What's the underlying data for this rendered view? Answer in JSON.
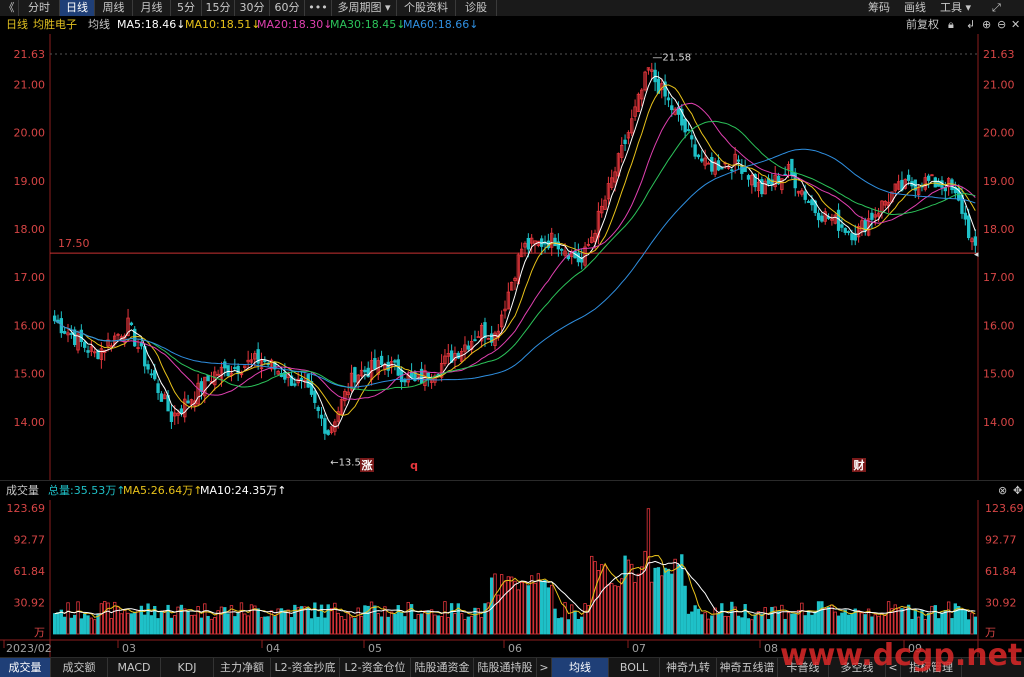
{
  "toolbar": {
    "back": "《",
    "tabs": [
      "分时",
      "日线",
      "周线",
      "月线",
      "5分",
      "15分",
      "30分",
      "60分",
      "•••",
      "多周期图 ▾",
      "个股资料",
      "诊股"
    ],
    "active_tab": "日线",
    "right": [
      "筹码",
      "画线",
      "工具 ▾"
    ]
  },
  "ma_bar": {
    "period": "日线",
    "stock_name": "均胜电子",
    "label": "均线",
    "ma5": "MA5:18.46↓",
    "ma10": "MA10:18.51↓",
    "ma20": "MA20:18.30↓",
    "ma30": "MA30:18.45↓",
    "ma60": "MA60:18.66↓",
    "adjust": "前复权"
  },
  "colors": {
    "up": "#e8373d",
    "down": "#1fc1c8",
    "ma5": "#ffffff",
    "ma10": "#e8c21a",
    "ma20": "#e040b0",
    "ma30": "#2cc35a",
    "ma60": "#2f8fe0"
  },
  "price_axis": {
    "ticks": [
      "21.63",
      "21.00",
      "20.00",
      "19.00",
      "18.00",
      "17.00",
      "16.00",
      "15.00",
      "14.00"
    ],
    "ref_line": "17.50",
    "high_label": "21.58",
    "low_label": "13.51"
  },
  "markers": {
    "zhang": "涨",
    "q": "q",
    "cai": "财"
  },
  "volume_bar": {
    "title": "成交量",
    "total": "总量:35.53万↑",
    "ma5": "MA5:26.64万↑",
    "ma10": "MA10:24.35万↑",
    "ticks": [
      "123.69",
      "92.77",
      "61.84",
      "30.92",
      "万"
    ],
    "dates": [
      "2023/02",
      "03",
      "04",
      "05",
      "06",
      "07",
      "08",
      "09"
    ]
  },
  "bottom_tabs": [
    "成交量",
    "成交额",
    "MACD",
    "KDJ",
    "主力净额",
    "L2-资金抄底",
    "L2-资金仓位",
    "陆股通资金",
    "陆股通持股",
    ">",
    "均线",
    "BOLL",
    "神奇九转",
    "神奇五线谱",
    "卡普线",
    "多空线",
    "<",
    "指标管理"
  ],
  "bottom_selected": [
    "成交量",
    "均线"
  ],
  "watermark": "www.dcgp.net",
  "chart_data": {
    "type": "candlestick",
    "title": "均胜电子 日线",
    "x_range": [
      "2023/02",
      "2023/09"
    ],
    "ylim": [
      13.5,
      21.63
    ],
    "price_high": 21.58,
    "price_low": 13.51,
    "reference": 17.5,
    "ohlc_keypoints": [
      {
        "date": "2023/02",
        "close": 16.1
      },
      {
        "date": "2023/03",
        "close": 15.4
      },
      {
        "date": "2023/03 late",
        "close": 14.1
      },
      {
        "date": "2023/04",
        "close": 15.0
      },
      {
        "date": "2023/05",
        "close": 13.8
      },
      {
        "date": "2023/05 late",
        "close": 15.0
      },
      {
        "date": "2023/06",
        "close": 15.9
      },
      {
        "date": "2023/06 late",
        "close": 17.6
      },
      {
        "date": "2023/07",
        "close": 18.6
      },
      {
        "date": "2023/07 mid",
        "close": 21.58
      },
      {
        "date": "2023/08",
        "close": 19.2
      },
      {
        "date": "2023/08 late",
        "close": 17.9
      },
      {
        "date": "2023/09",
        "close": 18.9
      },
      {
        "date": "2023/09 end",
        "close": 17.5
      }
    ],
    "volume_ylim": [
      0,
      123.69
    ],
    "volume_unit": "万"
  }
}
